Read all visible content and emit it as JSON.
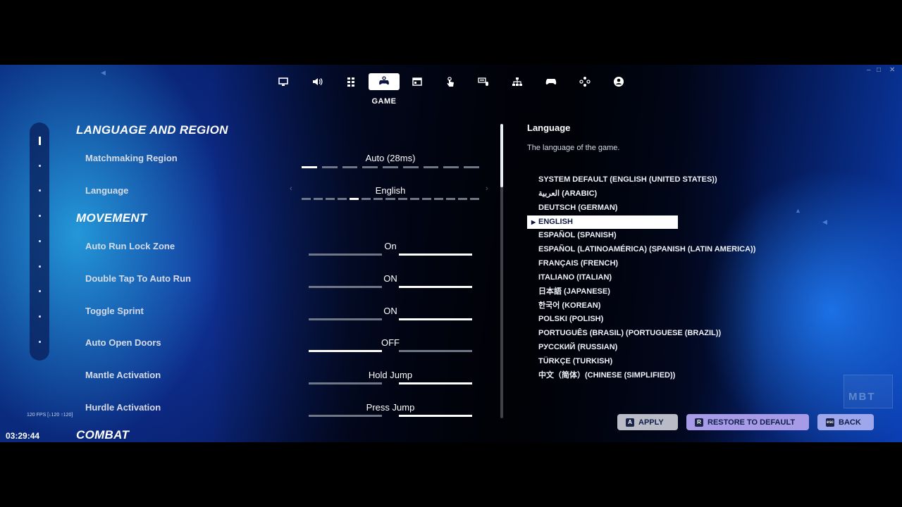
{
  "window": {
    "minimize": "–",
    "maximize": "□",
    "close": "✕"
  },
  "tabs": [
    {
      "icon": "monitor-icon"
    },
    {
      "icon": "speaker-icon"
    },
    {
      "icon": "grid-icon"
    },
    {
      "icon": "gamepad-settings-icon",
      "active": true,
      "label": "GAME"
    },
    {
      "icon": "window-icon"
    },
    {
      "icon": "touch-icon"
    },
    {
      "icon": "keyboard-mouse-icon"
    },
    {
      "icon": "network-icon"
    },
    {
      "icon": "controller-icon"
    },
    {
      "icon": "dpad-icon"
    },
    {
      "icon": "account-icon"
    }
  ],
  "active_tab_label": "GAME",
  "sections": {
    "language_region": "LANGUAGE AND REGION",
    "movement": "MOVEMENT",
    "combat": "COMBAT"
  },
  "settings": [
    {
      "label": "Matchmaking Region",
      "value": "Auto (28ms)",
      "kind": "segments",
      "count": 9,
      "selected": 0
    },
    {
      "label": "Language",
      "value": "English",
      "kind": "segments",
      "count": 15,
      "selected": 4
    },
    {
      "label": "Auto Run Lock Zone",
      "value": "On",
      "kind": "toggle",
      "on": true
    },
    {
      "label": "Double Tap To Auto Run",
      "value": "ON",
      "kind": "toggle",
      "on": true
    },
    {
      "label": "Toggle Sprint",
      "value": "ON",
      "kind": "toggle",
      "on": true
    },
    {
      "label": "Auto Open Doors",
      "value": "OFF",
      "kind": "toggle",
      "on": false
    },
    {
      "label": "Mantle Activation",
      "value": "Hold Jump",
      "kind": "toggle",
      "on": true
    },
    {
      "label": "Hurdle Activation",
      "value": "Press Jump",
      "kind": "toggle",
      "on": true
    }
  ],
  "info": {
    "title": "Language",
    "description": "The language of the game."
  },
  "languages": [
    "SYSTEM DEFAULT (ENGLISH (UNITED STATES))",
    "العربية (ARABIC)",
    "DEUTSCH (GERMAN)",
    "ENGLISH",
    "ESPAÑOL (SPANISH)",
    "ESPAÑOL (LATINOAMÉRICA) (SPANISH (LATIN AMERICA))",
    "FRANÇAIS (FRENCH)",
    "ITALIANO (ITALIAN)",
    "日本語 (JAPANESE)",
    "한국어 (KOREAN)",
    "POLSKI (POLISH)",
    "PORTUGUÊS (BRASIL) (PORTUGUESE (BRAZIL))",
    "РУССКИЙ (RUSSIAN)",
    "TÜRKÇE (TURKISH)",
    "中文（简体）(CHINESE (SIMPLIFIED))"
  ],
  "selected_language_index": 3,
  "buttons": {
    "apply": {
      "key": "A",
      "label": "APPLY"
    },
    "restore": {
      "key": "R",
      "label": "RESTORE TO DEFAULT"
    },
    "back": {
      "key": "esc",
      "label": "BACK"
    }
  },
  "hud": {
    "fps": "120 FPS [↓120 ↑120]",
    "clock": "03:29:44"
  },
  "watermark": "MBT",
  "colors": {
    "on": "#ffffff",
    "off": "#6f7787",
    "apply_bg": "#b9bcc6",
    "restore_bg": "#a79be8",
    "back_bg": "#9ea6ec"
  }
}
